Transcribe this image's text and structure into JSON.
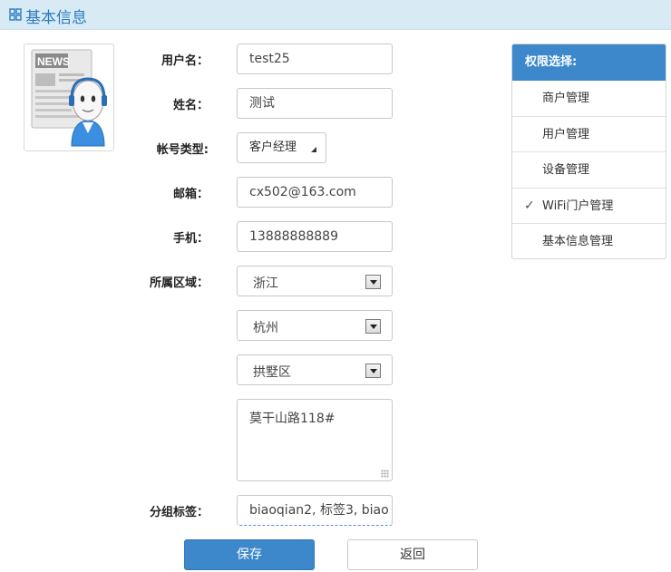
{
  "header": {
    "title": "基本信息",
    "icon": "grid-icon"
  },
  "avatar": {
    "icon": "news-reader-avatar-icon",
    "badge_text": "NEWS"
  },
  "form": {
    "username": {
      "label": "用户名：",
      "value": "test25"
    },
    "name": {
      "label": "姓名：",
      "value": "测试"
    },
    "account_type": {
      "label": "帐号类型:",
      "value": "客户经理"
    },
    "email": {
      "label": "邮箱：",
      "value": "cx502@163.com"
    },
    "phone": {
      "label": "手机：",
      "value": "13888888889"
    },
    "region": {
      "label": "所属区域：",
      "province": "浙江",
      "city": "杭州",
      "district": "拱墅区",
      "address": "莫干山路118#"
    },
    "tags": {
      "label": "分组标签：",
      "value": "biaoqian2, 标签3, biao"
    }
  },
  "buttons": {
    "save": "保存",
    "back": "返回"
  },
  "permissions": {
    "title": "权限选择:",
    "items": [
      {
        "label": "商户管理",
        "checked": false
      },
      {
        "label": "用户管理",
        "checked": false
      },
      {
        "label": "设备管理",
        "checked": false
      },
      {
        "label": "WiFi门户管理",
        "checked": true
      },
      {
        "label": "基本信息管理",
        "checked": false
      }
    ],
    "check_mark": "✓"
  },
  "colors": {
    "accent": "#3d87cb",
    "header_bg": "#d8ebf5",
    "title": "#2b7bbf"
  }
}
